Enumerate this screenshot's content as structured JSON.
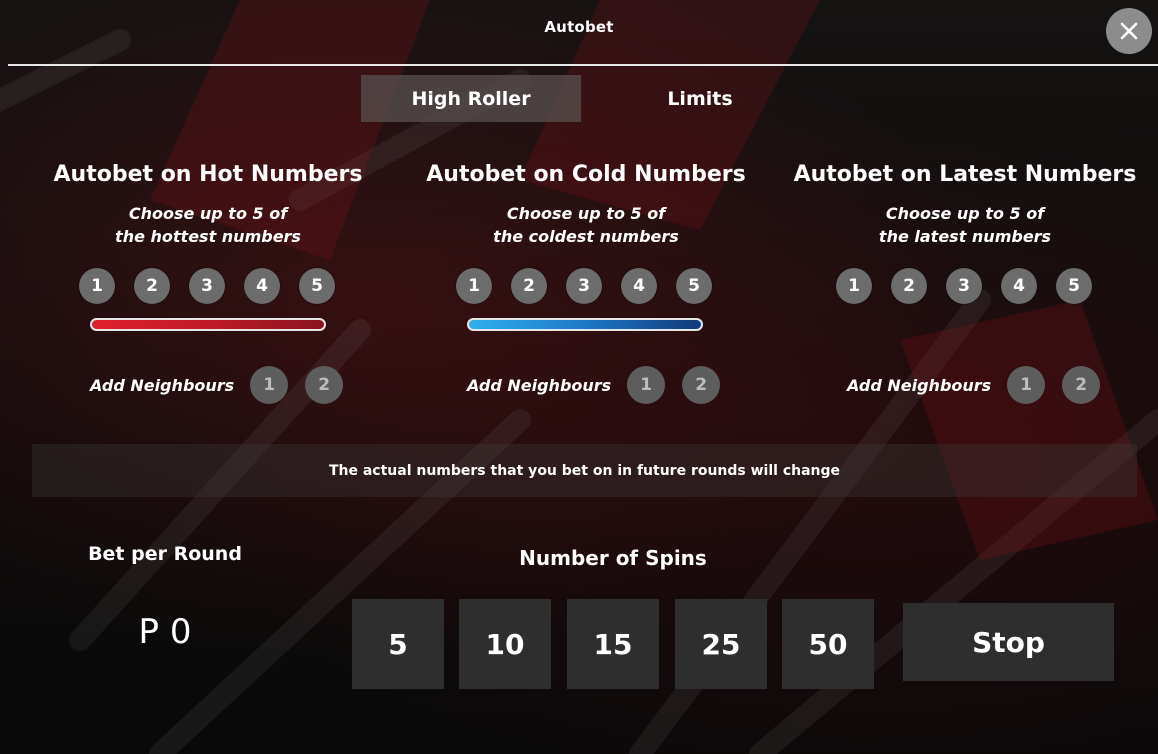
{
  "header": {
    "title": "Autobet",
    "close_icon": "close-icon"
  },
  "tabs": [
    {
      "label": "High Roller",
      "active": true
    },
    {
      "label": "Limits",
      "active": false
    }
  ],
  "columns": [
    {
      "title": "Autobet on Hot Numbers",
      "subtitle_line1": "Choose up to 5 of",
      "subtitle_line2": "the hottest numbers",
      "numbers": [
        "1",
        "2",
        "3",
        "4",
        "5"
      ],
      "bar_type": "hot",
      "neighbours_label": "Add Neighbours",
      "neighbours": [
        "1",
        "2"
      ]
    },
    {
      "title": "Autobet on Cold Numbers",
      "subtitle_line1": "Choose up to 5 of",
      "subtitle_line2": "the coldest numbers",
      "numbers": [
        "1",
        "2",
        "3",
        "4",
        "5"
      ],
      "bar_type": "cold",
      "neighbours_label": "Add Neighbours",
      "neighbours": [
        "1",
        "2"
      ]
    },
    {
      "title": "Autobet on Latest Numbers",
      "subtitle_line1": "Choose up to 5 of",
      "subtitle_line2": "the latest numbers",
      "numbers": [
        "1",
        "2",
        "3",
        "4",
        "5"
      ],
      "bar_type": "none",
      "neighbours_label": "Add Neighbours",
      "neighbours": [
        "1",
        "2"
      ]
    }
  ],
  "notice": "The actual numbers that you bet on in future rounds will change",
  "bet": {
    "label": "Bet per Round",
    "value": "P 0"
  },
  "spins": {
    "label": "Number of Spins",
    "options": [
      "5",
      "10",
      "15",
      "25",
      "50"
    ],
    "stop_label": "Stop"
  },
  "colors": {
    "hot_start": "#e0202c",
    "hot_end": "#8a1420",
    "cold_start": "#2fb0ef",
    "cold_end": "#113a7a",
    "chip": "#6c6c6c",
    "button_bg": "#2e2e2e"
  }
}
